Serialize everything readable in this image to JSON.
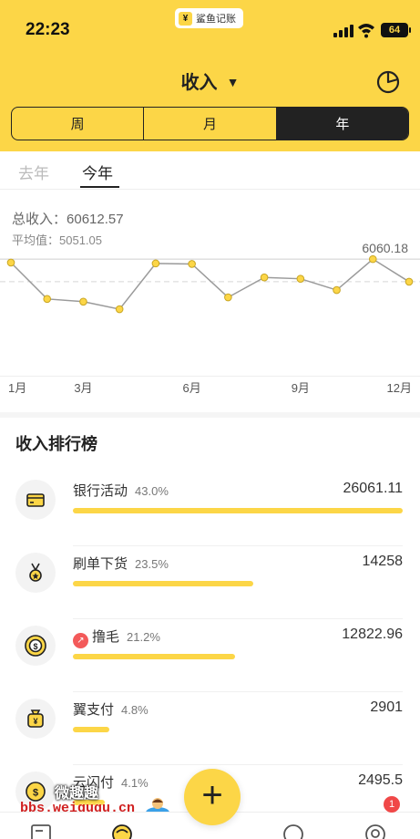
{
  "status_bar": {
    "time": "22:23",
    "app_pill_logo": "¥",
    "app_pill_label": "鲨鱼记账",
    "battery": "64"
  },
  "nav": {
    "title": "收入",
    "caret": "▼",
    "right_icon": "pie-chart-icon"
  },
  "segments": [
    {
      "label": "周",
      "active": false
    },
    {
      "label": "月",
      "active": false
    },
    {
      "label": "年",
      "active": true
    }
  ],
  "year_tabs": {
    "previous": "去年",
    "current": "今年"
  },
  "summary": {
    "total_label": "总收入：",
    "total_value": "60612.57",
    "average_label": "平均值：",
    "average_value": "5051.05"
  },
  "chart_data": {
    "type": "line",
    "x": [
      "1月",
      "2月",
      "3月",
      "4月",
      "5月",
      "6月",
      "7月",
      "8月",
      "9月",
      "10月",
      "11月",
      "12月"
    ],
    "x_tick_labels": [
      "1月",
      "3月",
      "6月",
      "9月",
      "12月"
    ],
    "values": [
      5930,
      4580,
      4480,
      4200,
      5900,
      5880,
      4640,
      5380,
      5330,
      4910,
      6060.18,
      5220
    ],
    "max_label": "6060.18",
    "average": 5051.05,
    "ylim": [
      0,
      6300
    ],
    "grid": false,
    "colors": {
      "line": "#9a9a9a",
      "point": "#FCD647",
      "point_stroke": "#c9a623",
      "average_line": "#d8d8d8"
    }
  },
  "ranking": {
    "title": "收入排行榜",
    "items": [
      {
        "name": "银行活动",
        "percent": "43.0%",
        "amount": "26061.11",
        "share": 1.0,
        "icon": "bank-card-icon",
        "badge": false
      },
      {
        "name": "刷单下货",
        "percent": "23.5%",
        "amount": "14258",
        "share": 0.547,
        "icon": "medal-icon",
        "badge": false
      },
      {
        "name": "撸毛",
        "percent": "21.2%",
        "amount": "12822.96",
        "share": 0.492,
        "icon": "coin-chip-icon",
        "badge": true,
        "badge_icon": "trend-up-icon"
      },
      {
        "name": "翼支付",
        "percent": "4.8%",
        "amount": "2901",
        "share": 0.111,
        "icon": "money-bag-icon",
        "badge": false
      },
      {
        "name": "云闪付",
        "percent": "4.1%",
        "amount": "2495.5",
        "share": 0.096,
        "icon": "coin-icon",
        "badge": false
      }
    ]
  },
  "bottom_nav": {
    "fab": "+",
    "notification_count": "1"
  },
  "watermark": {
    "line1": "微趣趣",
    "line2": "bbs.weiququ.cn"
  },
  "colors": {
    "brand_yellow": "#FCD647",
    "dark": "#222222",
    "badge_red": "#f04848"
  }
}
